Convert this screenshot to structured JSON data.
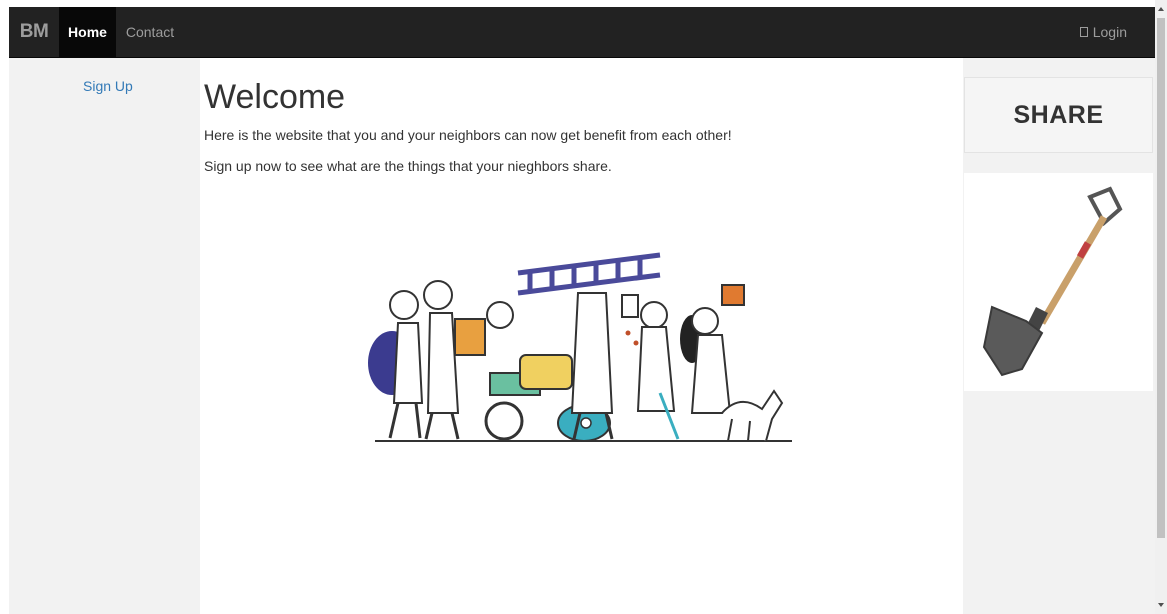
{
  "navbar": {
    "brand": "BM",
    "home": "Home",
    "contact": "Contact",
    "login": "Login"
  },
  "sidebar_left": {
    "signup": "Sign Up"
  },
  "main": {
    "title": "Welcome",
    "paragraph1": "Here is the website that you and your neighbors can now get benefit from each other!",
    "paragraph2": "Sign up now to see what are the things that your nieghbors share."
  },
  "sidebar_right": {
    "share_label": "SHARE"
  },
  "colors": {
    "navbar_bg": "#222222",
    "active_tab": "#080808",
    "link": "#337ab7",
    "sidebar_bg": "#f2f2f2"
  }
}
